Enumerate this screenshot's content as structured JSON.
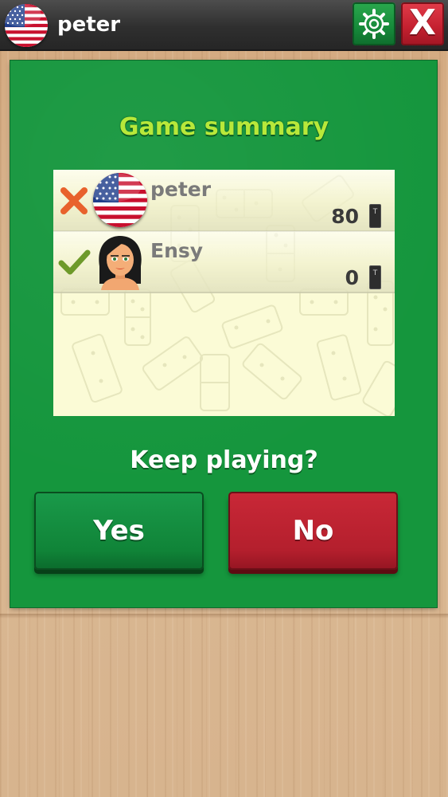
{
  "header": {
    "username": "peter",
    "settings_icon": "gear-icon",
    "close_label": "X"
  },
  "summary": {
    "title": "Game summary",
    "players": [
      {
        "name": "peter",
        "score": "80",
        "result": "lost",
        "status_icon": "cross-icon",
        "avatar": "usa-flag",
        "tile_icon_label": "T"
      },
      {
        "name": "Ensy",
        "score": "0",
        "result": "won",
        "status_icon": "checkmark-icon",
        "avatar": "woman-avatar",
        "tile_icon_label": "T"
      }
    ]
  },
  "prompt": {
    "question": "Keep playing?",
    "yes_label": "Yes",
    "no_label": "No"
  },
  "colors": {
    "table_green": "#15963d",
    "title_green": "#b8e83a",
    "yes_button": "#108438",
    "no_button": "#b41f2d",
    "topbar": "#2f2f2f"
  }
}
